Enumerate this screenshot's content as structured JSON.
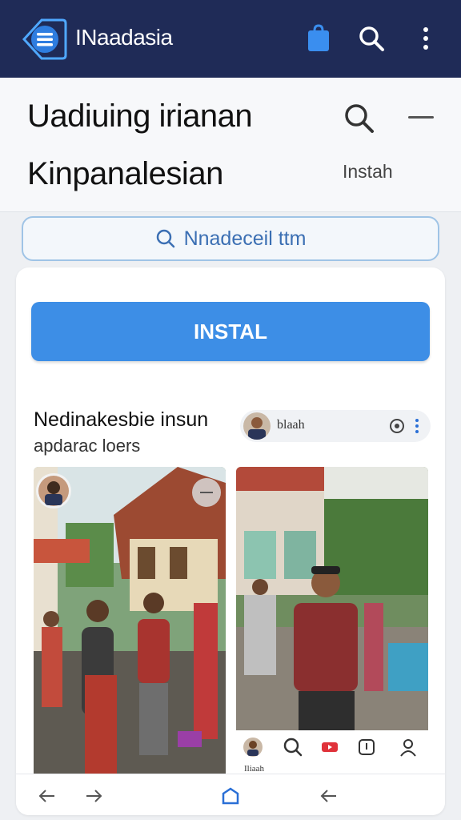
{
  "appbar": {
    "title": "INaadasia",
    "icons": [
      "menu-logo-icon",
      "shopping-bag-icon",
      "search-icon",
      "more-vertical-icon"
    ],
    "background": "#1f2b57"
  },
  "header": {
    "headline_line1": "Uadiuing irianan",
    "headline_line2": "Kinpanalesian",
    "install_label": "Instah"
  },
  "search": {
    "value": "Nnadeceil ttm"
  },
  "card": {
    "install_button": "INSTAL",
    "post_title": "Nedinakesbie insun",
    "post_subtitle": "apdarac loers",
    "author_chip": {
      "name": "blaah"
    },
    "right_caption": "Iliaah"
  },
  "colors": {
    "accent": "#3d8ee6",
    "search_text": "#3b6fb3",
    "appbar": "#1f2b57"
  },
  "bottom_nav": [
    "back-arrow-icon",
    "forward-arrow-icon",
    "home-icon",
    "back-arrow-icon"
  ]
}
